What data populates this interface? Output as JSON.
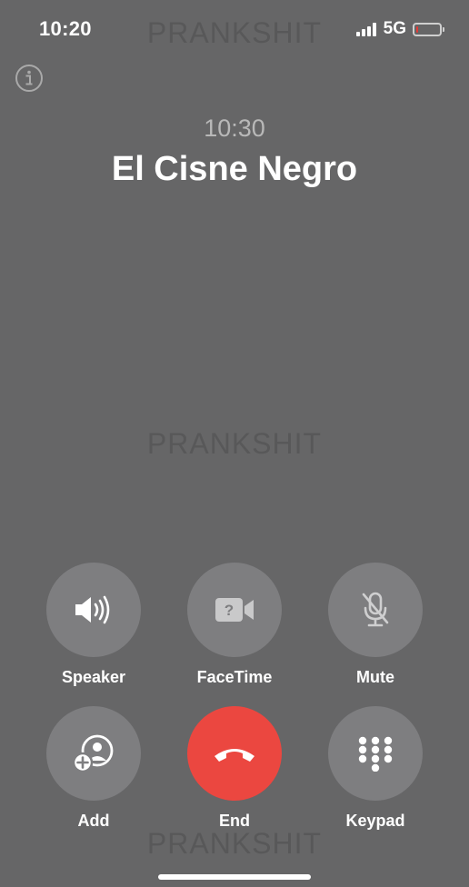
{
  "status_bar": {
    "time": "10:20",
    "network": "5G",
    "signal_bars": 4,
    "battery_level": 0.1,
    "battery_color": "#e53935"
  },
  "watermark": "PRANKSHIT",
  "info_icon": "info-circle-icon",
  "call": {
    "duration": "10:30",
    "contact_name": "El Cisne Negro"
  },
  "controls": {
    "speaker": {
      "label": "Speaker",
      "icon": "speaker-icon"
    },
    "facetime": {
      "label": "FaceTime",
      "icon": "facetime-video-icon"
    },
    "mute": {
      "label": "Mute",
      "icon": "mic-slash-icon"
    },
    "add": {
      "label": "Add",
      "icon": "add-call-icon"
    },
    "end": {
      "label": "End",
      "icon": "phone-hangup-icon",
      "color": "#eb4740"
    },
    "keypad": {
      "label": "Keypad",
      "icon": "keypad-grid-icon"
    }
  }
}
